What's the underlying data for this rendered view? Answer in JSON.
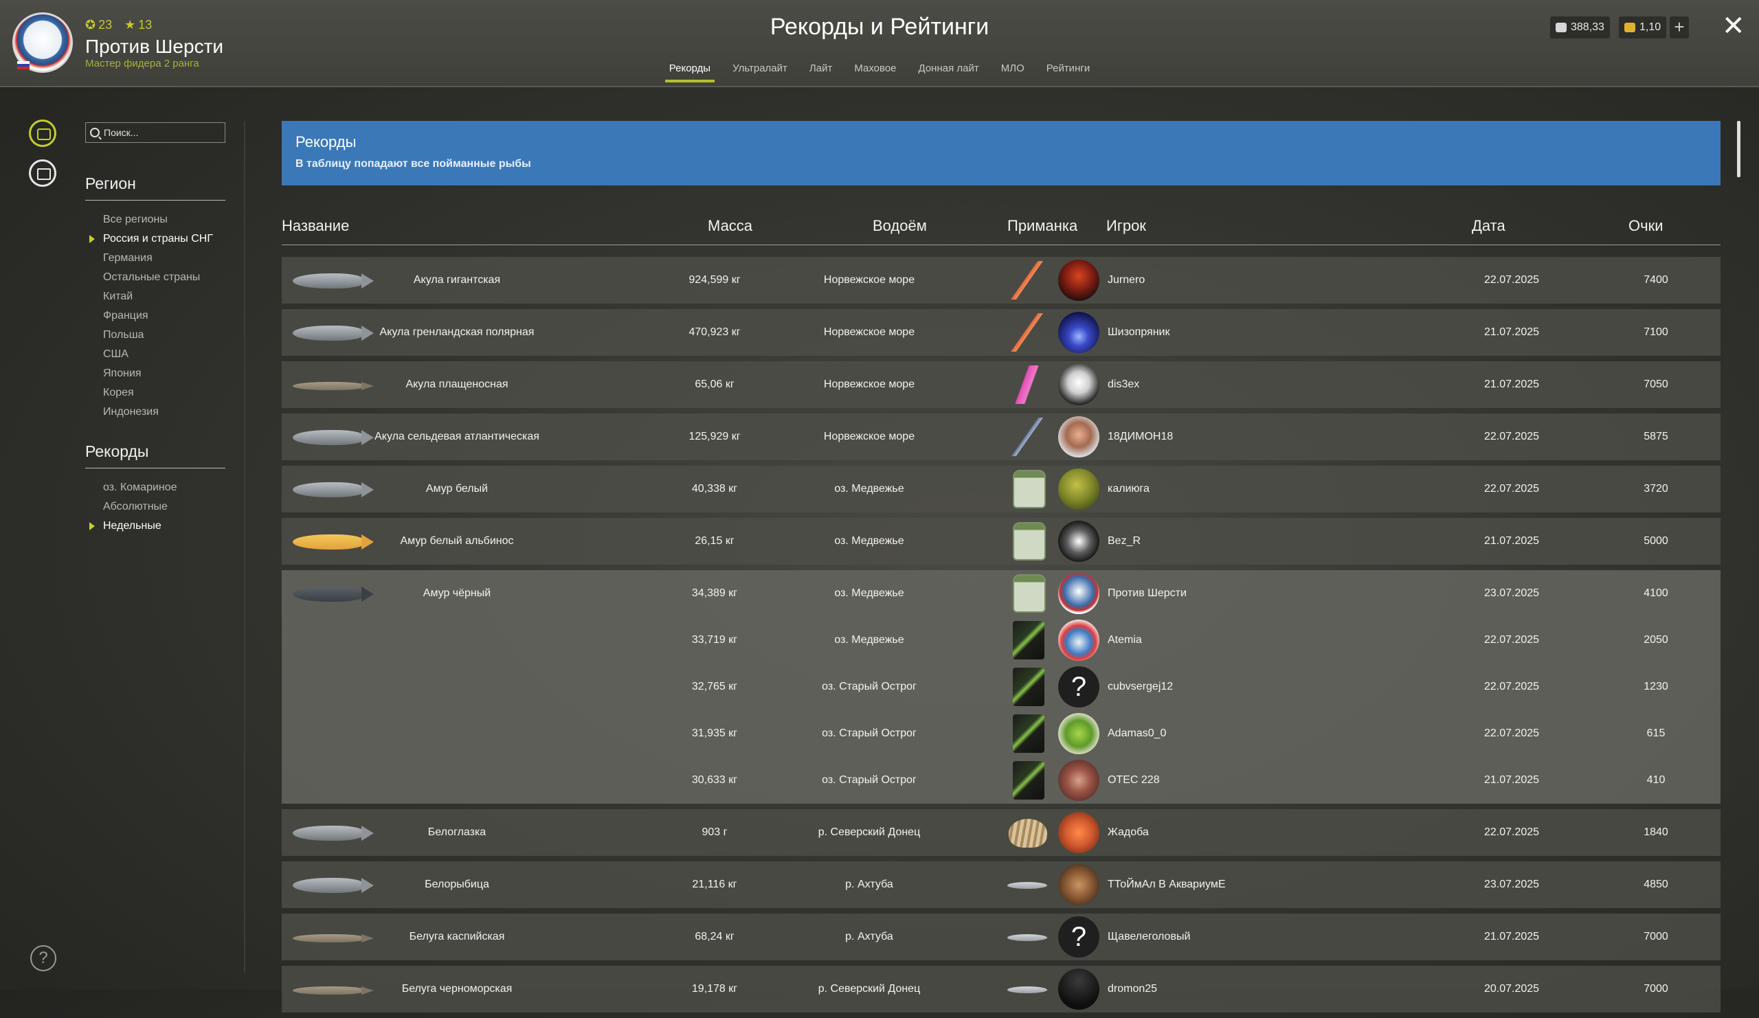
{
  "header": {
    "title": "Рекорды и Рейтинги",
    "player": {
      "name": "Против Шерсти",
      "rank": "Мастер фидера 2 ранга",
      "level": "23",
      "stars": "13"
    },
    "currency": [
      {
        "name": "silver",
        "value": "388,33"
      },
      {
        "name": "gold",
        "value": "1,10"
      }
    ],
    "plus_label": "+",
    "close_label": "✕",
    "tabs": [
      "Рекорды",
      "Ультралайт",
      "Лайт",
      "Маховое",
      "Донная лайт",
      "МЛО",
      "Рейтинги"
    ],
    "active_tab": "Рекорды"
  },
  "sidebar": {
    "search_placeholder": "Поиск...",
    "region_title": "Регион",
    "regions": [
      "Все регионы",
      "Россия и страны СНГ",
      "Германия",
      "Остальные страны",
      "Китай",
      "Франция",
      "Польша",
      "США",
      "Япония",
      "Корея",
      "Индонезия"
    ],
    "selected_region": "Россия и страны СНГ",
    "records_title": "Рекорды",
    "records": [
      "оз. Комариное",
      "Абсолютные",
      "Недельные"
    ],
    "selected_record": "Недельные",
    "help_label": "?"
  },
  "banner": {
    "title": "Рекорды",
    "subtitle": "В таблицу попадают все пойманные рыбы"
  },
  "table": {
    "headers": {
      "name": "Название",
      "mass": "Масса",
      "lake": "Водоём",
      "bait": "Приманка",
      "player": "Игрок",
      "date": "Дата",
      "score": "Очки"
    },
    "rows": [
      {
        "name": "Акула гигантская",
        "mass": "924,599 кг",
        "lake": "Норвежское море",
        "player": "Jurnero",
        "date": "22.07.2025",
        "score": "7400"
      },
      {
        "name": "Акула гренландская полярная",
        "mass": "470,923 кг",
        "lake": "Норвежское море",
        "player": "Шизопряник",
        "date": "21.07.2025",
        "score": "7100"
      },
      {
        "name": "Акула плащеносная",
        "mass": "65,06 кг",
        "lake": "Норвежское море",
        "player": "dis3ex",
        "date": "21.07.2025",
        "score": "7050"
      },
      {
        "name": "Акула сельдевая атлантическая",
        "mass": "125,929 кг",
        "lake": "Норвежское море",
        "player": "18ДИМОН18",
        "date": "22.07.2025",
        "score": "5875"
      },
      {
        "name": "Амур белый",
        "mass": "40,338 кг",
        "lake": "оз. Медвежье",
        "player": "калиюга",
        "date": "22.07.2025",
        "score": "3720"
      },
      {
        "name": "Амур белый альбинос",
        "mass": "26,15 кг",
        "lake": "оз. Медвежье",
        "player": "Bez_R",
        "date": "21.07.2025",
        "score": "5000"
      }
    ],
    "group": {
      "name": "Амур чёрный",
      "entries": [
        {
          "mass": "34,389 кг",
          "lake": "оз. Медвежье",
          "player": "Против Шерсти",
          "date": "23.07.2025",
          "score": "4100"
        },
        {
          "mass": "33,719 кг",
          "lake": "оз. Медвежье",
          "player": "Atemia",
          "date": "22.07.2025",
          "score": "2050"
        },
        {
          "mass": "32,765 кг",
          "lake": "оз. Старый Острог",
          "player": "cubvsergej12",
          "date": "22.07.2025",
          "score": "1230"
        },
        {
          "mass": "31,935 кг",
          "lake": "оз. Старый Острог",
          "player": "Adamas0_0",
          "date": "22.07.2025",
          "score": "615"
        },
        {
          "mass": "30,633 кг",
          "lake": "оз. Старый Острог",
          "player": "OTEC 228",
          "date": "21.07.2025",
          "score": "410"
        }
      ]
    },
    "rows_after": [
      {
        "name": "Белоглазка",
        "mass": "903 г",
        "lake": "р. Северский Донец",
        "player": "Жадоба",
        "date": "22.07.2025",
        "score": "1840"
      },
      {
        "name": "Белорыбица",
        "mass": "21,116 кг",
        "lake": "р. Ахтуба",
        "player": "ТТоЙмАл В АквариумЕ",
        "date": "23.07.2025",
        "score": "4850"
      },
      {
        "name": "Белуга каспийская",
        "mass": "68,24 кг",
        "lake": "р. Ахтуба",
        "player": "Щавелеголовый",
        "date": "21.07.2025",
        "score": "7000"
      },
      {
        "name": "Белуга черноморская",
        "mass": "19,178 кг",
        "lake": "р. Северский Донец",
        "player": "dromon25",
        "date": "20.07.2025",
        "score": "7000"
      }
    ]
  },
  "colors": {
    "accent": "#b5c22c",
    "banner": "#3b78b7"
  },
  "icons": {
    "side": [
      "camera-icon",
      "archive-icon"
    ],
    "help": "help-icon",
    "close": "close-icon",
    "search": "search-icon"
  }
}
